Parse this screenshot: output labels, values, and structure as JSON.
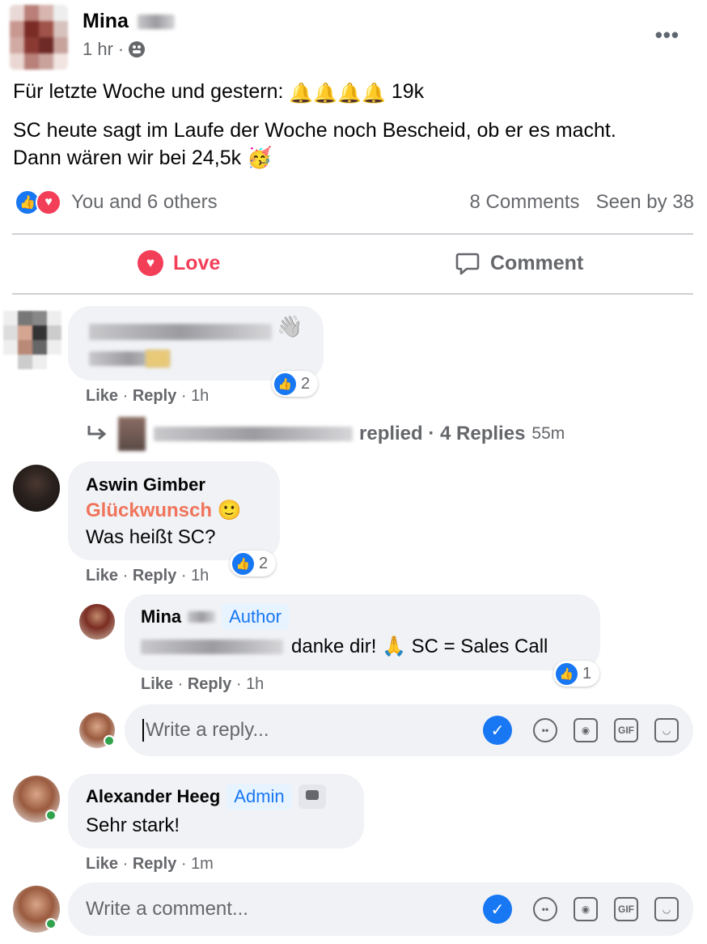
{
  "post": {
    "author_first": "Mina",
    "time": "1 hr",
    "line1_text": "Für letzte Woche und gestern:",
    "line1_emoji": "🔔🔔🔔🔔",
    "line1_value": "19k",
    "line2": "SC heute sagt im Laufe der Woche noch Bescheid, ob er es macht.",
    "line3_text": "Dann wären wir bei 24,5k",
    "line3_emoji": "🥳",
    "reactions_text": "You and 6 others",
    "comments_count": "8 Comments",
    "seen_by": "Seen by 38",
    "love_label": "Love",
    "comment_label": "Comment",
    "more_label": "•••"
  },
  "comments": {
    "first": {
      "emoji": "👋",
      "reaction_count": "2",
      "like": "Like",
      "reply": "Reply",
      "time": "1h",
      "replied_text": "replied",
      "replies_label": "4 Replies",
      "replies_time": "55m"
    },
    "aswin": {
      "name": "Aswin Gimber",
      "highlight": "Glückwunsch",
      "highlight_emoji": "🙂",
      "text": "Was heißt SC?",
      "reaction_count": "2",
      "like": "Like",
      "reply": "Reply",
      "time": "1h"
    },
    "mina_reply": {
      "name": "Mina",
      "tag": "Author",
      "text": "danke dir! 🙏 SC = Sales Call",
      "reaction_count": "1",
      "like": "Like",
      "reply": "Reply",
      "time": "1h"
    },
    "reply_box": {
      "placeholder": "Write a reply..."
    },
    "alexander": {
      "name": "Alexander Heeg",
      "tag": "Admin",
      "text": "Sehr stark!",
      "like": "Like",
      "reply": "Reply",
      "time": "1m"
    },
    "comment_box": {
      "placeholder": "Write a comment..."
    }
  },
  "icons": {
    "gif": "GIF",
    "check": "✓",
    "like_thumb": "👍",
    "heart": "♥"
  },
  "colors": {
    "accent": "#1877f2",
    "love": "#f33e58",
    "highlight": "#f0745b",
    "online": "#31a24c"
  }
}
